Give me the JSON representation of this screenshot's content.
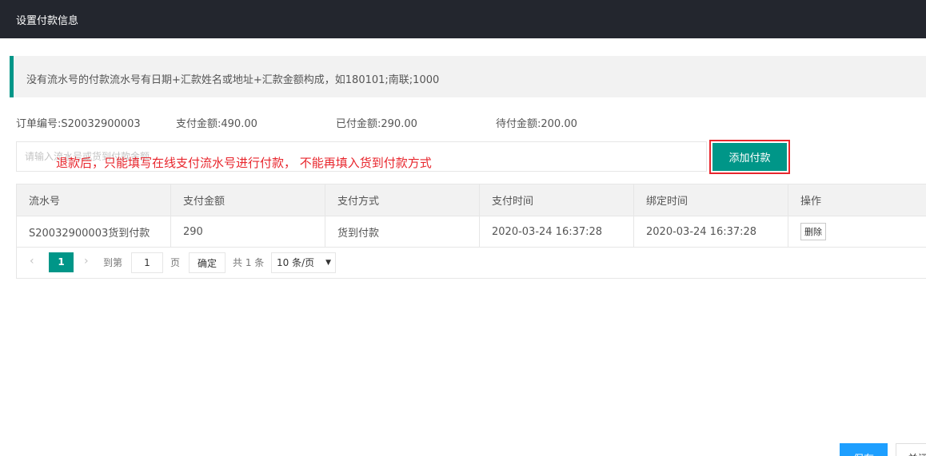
{
  "dialog": {
    "title": "设置付款信息"
  },
  "notice": {
    "text": "没有流水号的付款流水号有日期+汇款姓名或地址+汇款金额构成，如180101;南联;1000"
  },
  "order_info": {
    "order_no": "订单编号:S20032900003",
    "pay_amount": "支付金额:490.00",
    "paid_amount": "已付金额:290.00",
    "pending_amount": "待付金额:200.00"
  },
  "search": {
    "placeholder": "请输入流水号或货到付款金额"
  },
  "annotation": {
    "text": "退款后，只能填写在线支付流水号进行付款， 不能再填入货到付款方式",
    "color": "#e8262d"
  },
  "add_button": {
    "label": "添加付款"
  },
  "table": {
    "headers": [
      "流水号",
      "支付金额",
      "支付方式",
      "支付时间",
      "绑定时间",
      "操作"
    ],
    "rows": [
      {
        "serial": "S20032900003货到付款",
        "amount": "290",
        "method": "货到付款",
        "pay_time": "2020-03-24 16:37:28",
        "bind_time": "2020-03-24 16:37:28",
        "action": "删除"
      }
    ]
  },
  "pager": {
    "prev_icon": "chevron-left-icon",
    "next_icon": "chevron-right-icon",
    "current_page": "1",
    "goto_label": "到第",
    "page_input": "1",
    "page_unit": "页",
    "confirm": "确定",
    "total": "共 1 条",
    "page_size": "10 条/页"
  },
  "footer": {
    "save": "保存",
    "close": "关闭"
  },
  "colors": {
    "accent": "#009688",
    "titlebar": "#23262e",
    "primary": "#1e9fff"
  }
}
